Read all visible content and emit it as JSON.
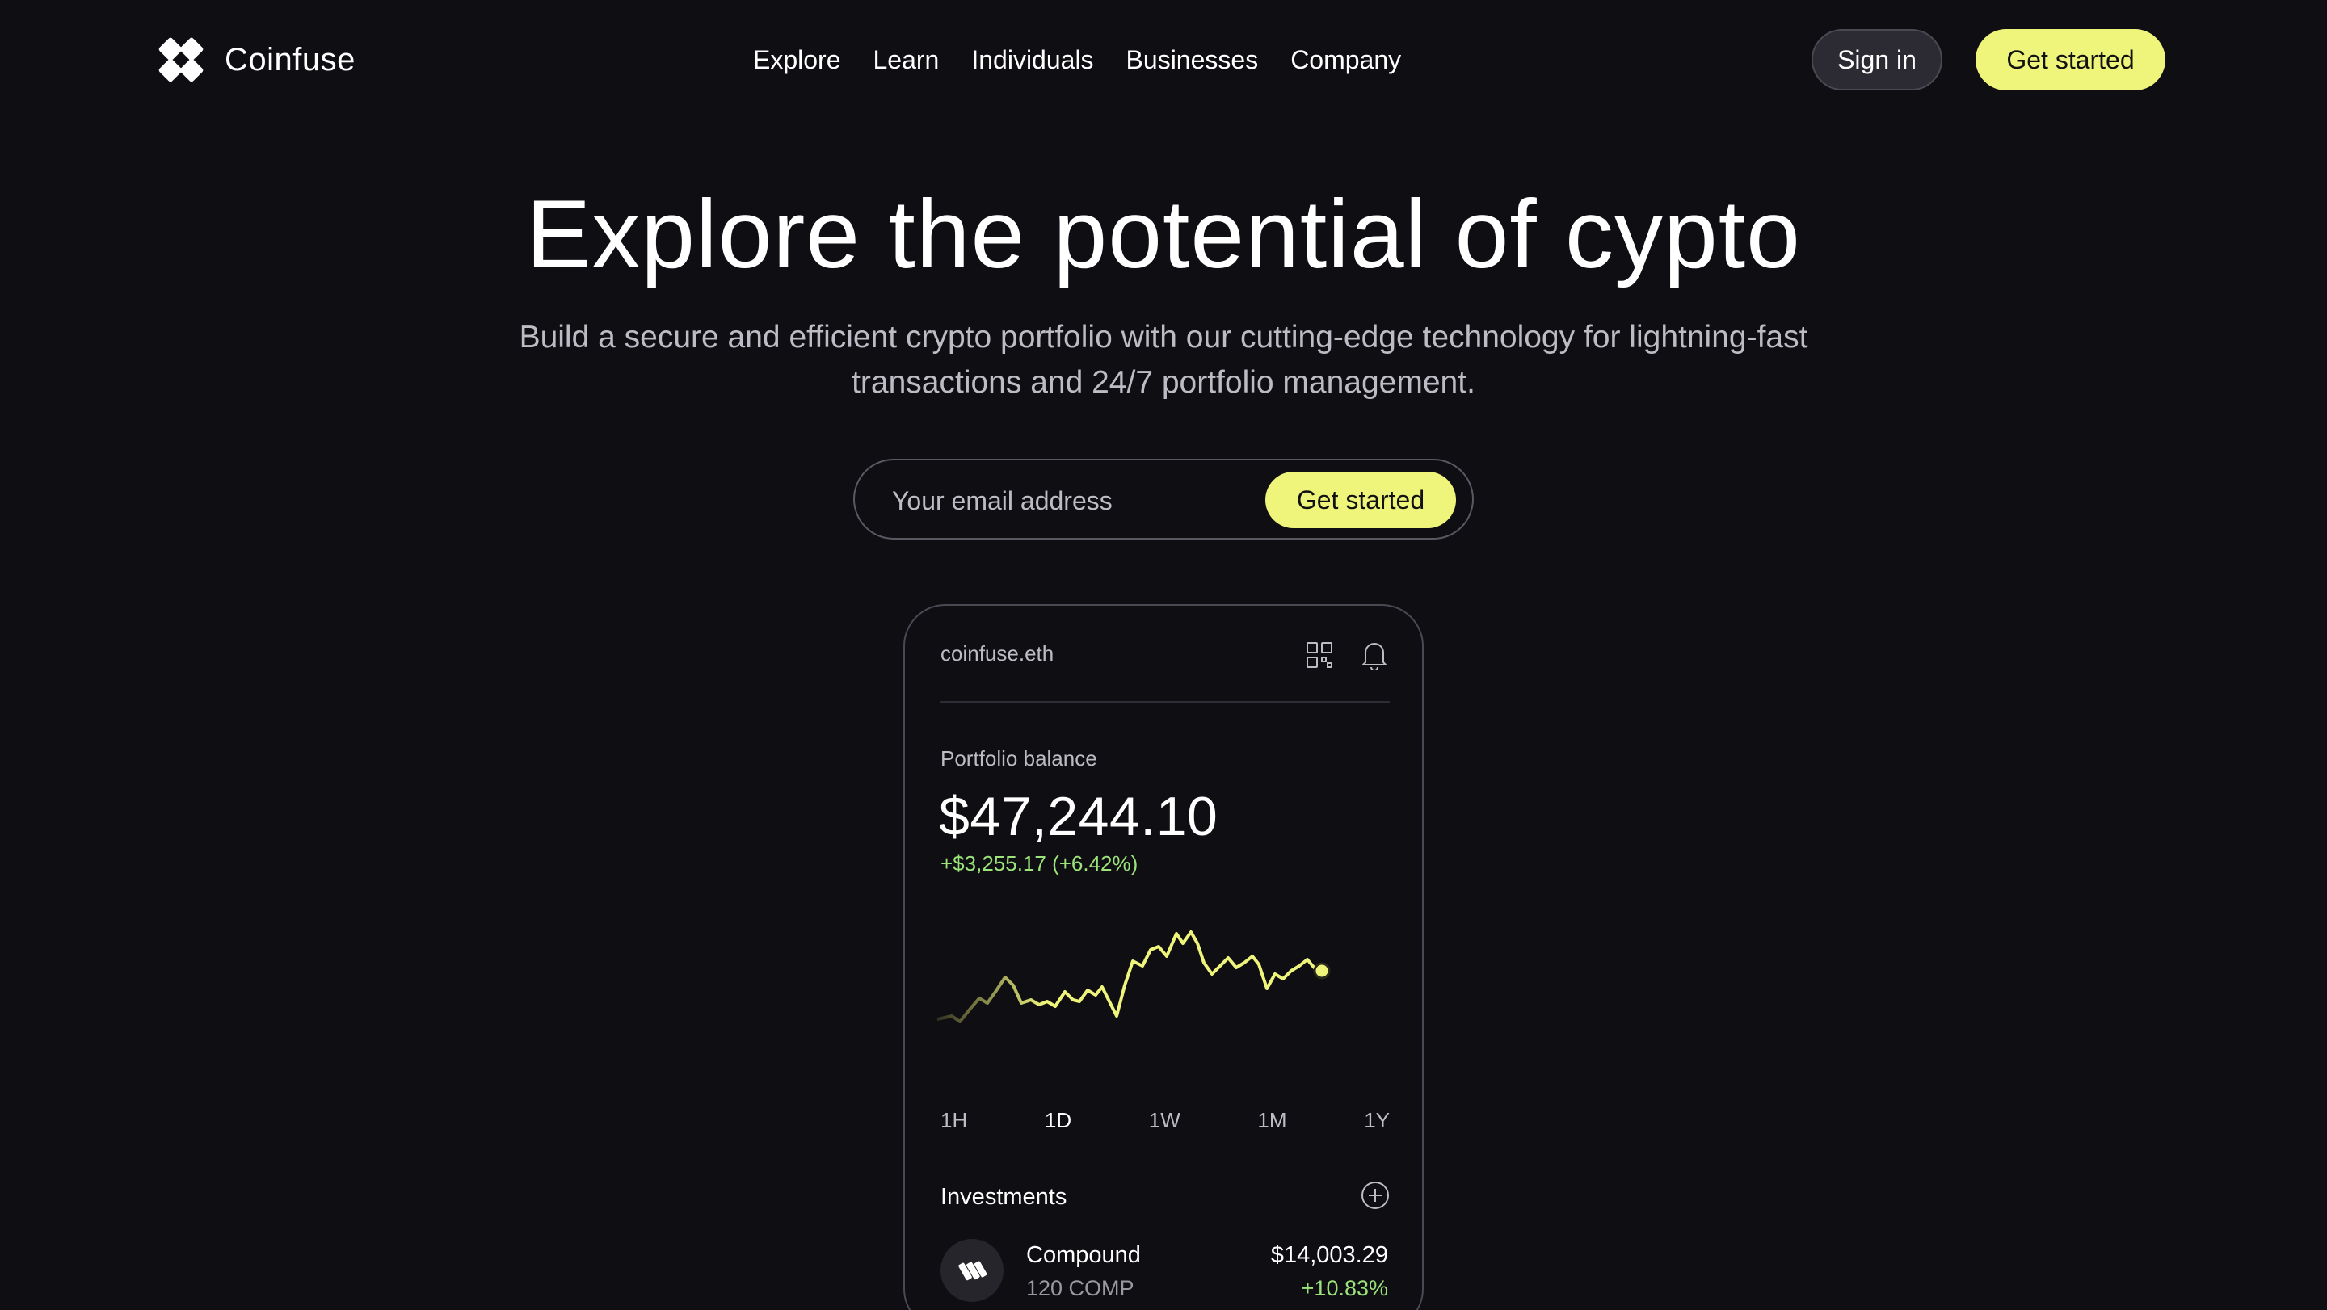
{
  "brand": {
    "name": "Coinfuse",
    "logo_icon": "diamond-cluster-icon"
  },
  "nav": {
    "items": [
      "Explore",
      "Learn",
      "Individuals",
      "Businesses",
      "Company"
    ]
  },
  "header": {
    "signin_label": "Sign in",
    "getstarted_label": "Get started"
  },
  "hero": {
    "title": "Explore the potential of cypto",
    "subtitle": "Build a secure and efficient crypto portfolio with our cutting-edge technology for lightning-fast transactions and 24/7 portfolio management.",
    "email_placeholder": "Your email address",
    "cta_label": "Get started"
  },
  "wallet": {
    "account": "coinfuse.eth",
    "portfolio_label": "Portfolio balance",
    "balance": "$47,244.10",
    "change": "+$3,255.17 (+6.42%)",
    "ranges": [
      "1H",
      "1D",
      "1W",
      "1M",
      "1Y"
    ],
    "active_range": "1D",
    "investments_label": "Investments",
    "assets": [
      {
        "name": "Compound",
        "quantity": "120 COMP",
        "value": "$14,003.29",
        "change": "+10.83%"
      }
    ]
  },
  "colors": {
    "background": "#0f0e13",
    "accent": "#eff57a",
    "positive": "#9be37a",
    "muted_text": "#bdbcc4"
  }
}
